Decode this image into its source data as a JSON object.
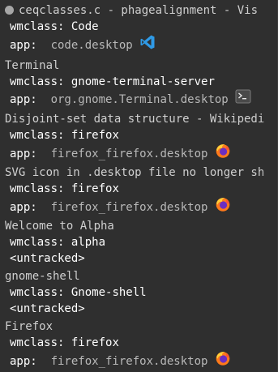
{
  "entries": [
    {
      "title": "ceqclasses.c - phagealignment - Vis",
      "wmclass_key": "wmclass:",
      "wmclass_value": "Code",
      "app_key": "app:",
      "app_value": "code.desktop",
      "icon": "vscode-icon"
    },
    {
      "title": "Terminal",
      "wmclass_key": "wmclass:",
      "wmclass_value": "gnome-terminal-server",
      "app_key": "app:",
      "app_value": "org.gnome.Terminal.desktop",
      "icon": "terminal-icon"
    },
    {
      "title": "Disjoint-set data structure - Wikipedi",
      "wmclass_key": "wmclass:",
      "wmclass_value": "firefox",
      "app_key": "app:",
      "app_value": "firefox_firefox.desktop",
      "icon": "firefox-icon"
    },
    {
      "title": "SVG icon in .desktop file no longer sh",
      "wmclass_key": "wmclass:",
      "wmclass_value": "firefox",
      "app_key": "app:",
      "app_value": "firefox_firefox.desktop",
      "icon": "firefox-icon"
    },
    {
      "title": "Welcome to Alpha",
      "wmclass_key": "wmclass:",
      "wmclass_value": "alpha",
      "untracked": "<untracked>"
    },
    {
      "title": "gnome-shell",
      "wmclass_key": "wmclass:",
      "wmclass_value": "Gnome-shell",
      "untracked": "<untracked>"
    },
    {
      "title": "Firefox",
      "wmclass_key": "wmclass:",
      "wmclass_value": "firefox",
      "app_key": "app:",
      "app_value": "firefox_firefox.desktop",
      "icon": "firefox-icon"
    }
  ],
  "colors": {
    "background": "#2f2f2f",
    "vscode_blue": "#2f9ae6",
    "firefox_orange": "#ff7a1a",
    "firefox_purple": "#6b2ec1"
  }
}
